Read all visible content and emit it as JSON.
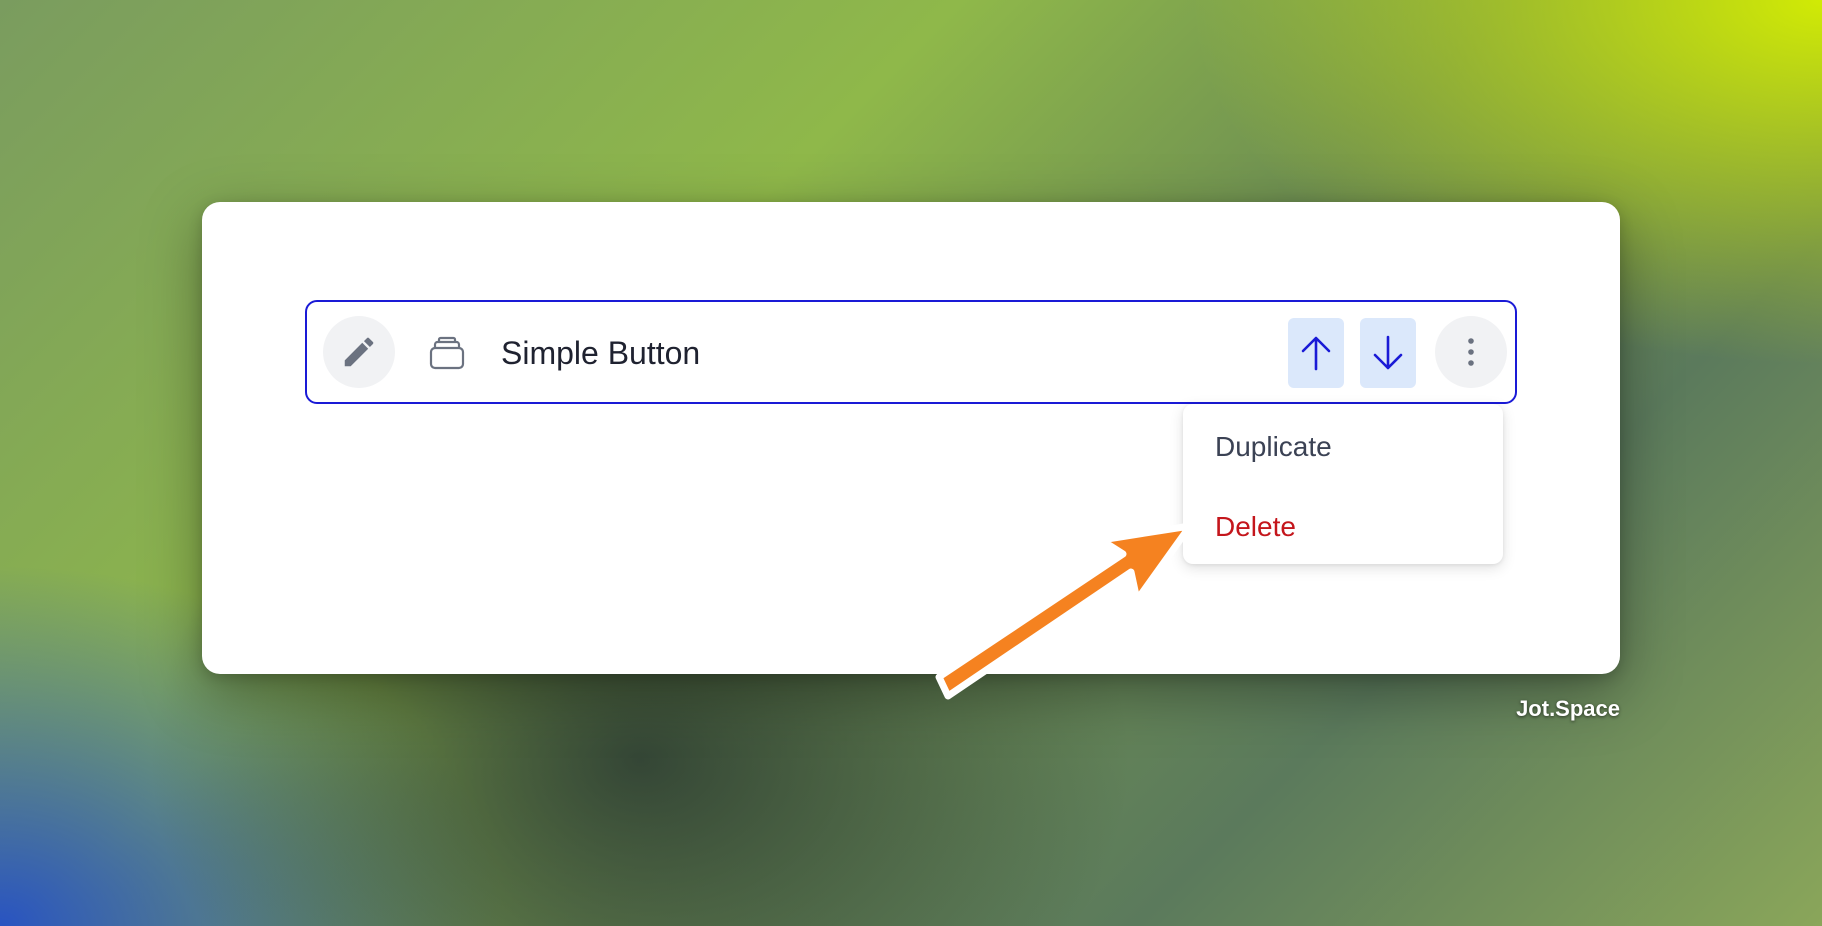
{
  "row": {
    "title": "Simple Button",
    "icons": {
      "edit": "pencil-icon",
      "block": "stacked-cards-icon",
      "move_up": "arrow-up-icon",
      "move_down": "arrow-down-icon",
      "more": "vertical-dots-icon"
    }
  },
  "menu": {
    "items": [
      {
        "label": "Duplicate",
        "color": "#3b4254"
      },
      {
        "label": "Delete",
        "color": "#c4161c"
      }
    ]
  },
  "watermark": "Jot.Space",
  "colors": {
    "row_border": "#1a1ad6",
    "arrow_button_bg": "#dbe8fb",
    "arrow_glyph": "#1a1ad6",
    "annotation_arrow": "#f58220",
    "delete_text": "#c4161c"
  },
  "annotation": {
    "type": "arrow-icon",
    "points_to": "Delete"
  }
}
